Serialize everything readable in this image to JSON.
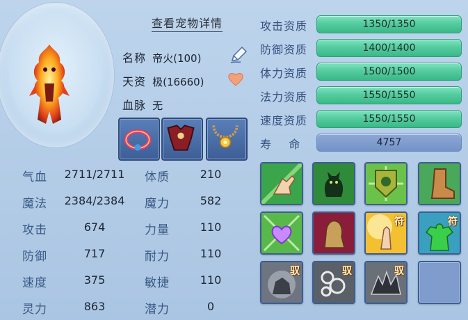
{
  "detail_link": "查看宠物详情",
  "info": {
    "name_label": "名称",
    "name_value": "帝火(100)",
    "talent_label": "天资",
    "talent_value": "极(16660)",
    "bloodline_label": "血脉",
    "bloodline_value": "无"
  },
  "stats": [
    {
      "l1": "气血",
      "v1": "2711/2711",
      "l2": "体质",
      "v2": "210"
    },
    {
      "l1": "魔法",
      "v1": "2384/2384",
      "l2": "魔力",
      "v2": "582"
    },
    {
      "l1": "攻击",
      "v1": "674",
      "l2": "力量",
      "v2": "110"
    },
    {
      "l1": "防御",
      "v1": "717",
      "l2": "耐力",
      "v2": "110"
    },
    {
      "l1": "速度",
      "v1": "375",
      "l2": "敏捷",
      "v2": "110"
    },
    {
      "l1": "灵力",
      "v1": "863",
      "l2": "潜力",
      "v2": "0"
    }
  ],
  "aptitudes": [
    {
      "label": "攻击资质",
      "value": "1350/1350"
    },
    {
      "label": "防御资质",
      "value": "1400/1400"
    },
    {
      "label": "体力资质",
      "value": "1500/1500"
    },
    {
      "label": "法力资质",
      "value": "1550/1550"
    },
    {
      "label": "速度资质",
      "value": "1550/1550"
    }
  ],
  "life": {
    "label": "寿    命",
    "value": "4757"
  },
  "skill_badges": {
    "fu": "符",
    "yu": "驭"
  },
  "colors": {
    "bar_green": "#55cc9f",
    "life_bar": "#7f9dcf",
    "label_blue": "#3a5a86",
    "bg": "#b4cde7"
  }
}
